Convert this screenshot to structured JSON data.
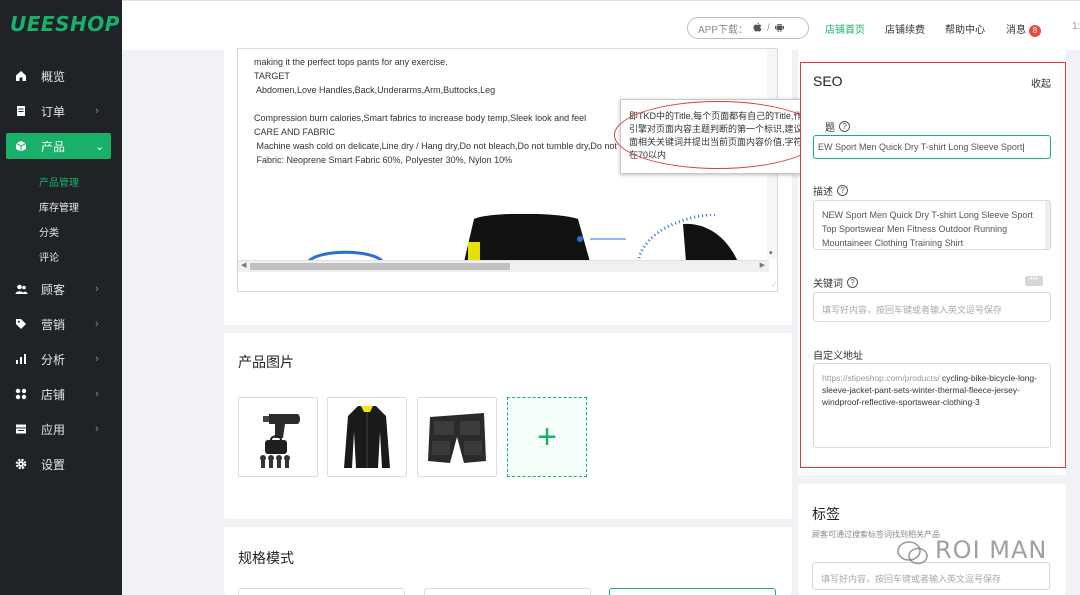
{
  "brand": {
    "logo": "UEESHOP",
    "accent": "#19b16a",
    "sidebar_bg": "#1f2328"
  },
  "sidebar": {
    "items": [
      {
        "label": "概览",
        "icon": "home-icon"
      },
      {
        "label": "订单",
        "icon": "order-icon"
      },
      {
        "label": "产品",
        "icon": "box-icon",
        "active": true
      },
      {
        "label": "顾客",
        "icon": "users-icon"
      },
      {
        "label": "营销",
        "icon": "tag-icon"
      },
      {
        "label": "分析",
        "icon": "bar-chart-icon"
      },
      {
        "label": "店铺",
        "icon": "grid-icon"
      },
      {
        "label": "应用",
        "icon": "app-icon"
      },
      {
        "label": "设置",
        "icon": "gear-icon"
      }
    ],
    "sub_items": [
      {
        "label": "产品管理",
        "active": true
      },
      {
        "label": "库存管理"
      },
      {
        "label": "分类"
      },
      {
        "label": "评论"
      }
    ]
  },
  "topbar": {
    "app_download": "APP下载：",
    "links": [
      "店铺首页",
      "店铺续费",
      "帮助中心",
      "消息"
    ],
    "message_count": "8",
    "trailing": "1:"
  },
  "editor": {
    "lines": [
      "making it the perfect tops pants for any exercise.",
      "TARGET",
      " Abdomen,Love Handles,Back,Underarms,Arm,Buttocks,Leg",
      "",
      "Compression burn calories,Smart fabrics to increase body temp,Sleek look and feel",
      "CARE AND FABRIC",
      " Machine wash cold on delicate,Line dry / Hang dry,Do not bleach,Do not tumble dry,Do not",
      " Fabric: Neoprene Smart Fabric 60%, Polyester 30%, Nylon 10%"
    ]
  },
  "product_images": {
    "title": "产品图片",
    "items": [
      "massage-gun-image",
      "black-jacket-image",
      "black-pants-image"
    ],
    "add_label": "+"
  },
  "specs": {
    "title": "规格模式"
  },
  "seo": {
    "title": "SEO",
    "collapse_label": "收起",
    "title_label": "题",
    "title_value": "EW Sport Men Quick Dry T-shirt Long Sleeve Sport",
    "description_label": "描述",
    "description_value": "NEW Sport Men Quick Dry T-shirt Long Sleeve Sport Top Sportswear Men Fitness Outdoor Running Mountaineer Clothing Training Shirt",
    "keywords_label": "关键词",
    "keywords_placeholder": "填写好内容，按回车键或者输入英文逗号保存",
    "url_label": "自定义地址",
    "url_prefix": "https://stipeshop.com/products/",
    "url_slug": "cycling-bike-bicycle-long-sleeve-jacket-pant-sets-winter-thermal-fleece-jersey-windproof-reflective-sportswear-clothing-3"
  },
  "tooltip": {
    "text": "即TKD中的Title,每个页面都有自己的Title,作为搜索引擎对页面内容主题判断的第一个标识,建议包含页面相关关键词并提出当前页面内容价值,字符数控制在70以内"
  },
  "tags": {
    "title": "标签",
    "hint": "顾客可通过搜索标签词找到相关产品",
    "placeholder": "填写好内容，按回车键或者输入英文逗号保存"
  },
  "watermark": "ROI MAN"
}
